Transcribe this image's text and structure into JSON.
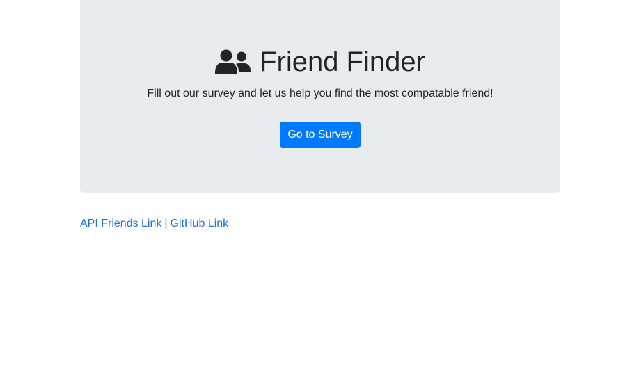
{
  "jumbotron": {
    "title": "Friend Finder",
    "title_icon": "user-friends-icon",
    "subtitle": "Fill out our survey and let us help you find the most compatable friend!",
    "button_label": "Go to Survey"
  },
  "footer": {
    "api_link": "API Friends Link",
    "separator": "|",
    "github_link": "GitHub Link"
  },
  "colors": {
    "jumbotron_bg": "#e9ecef",
    "primary_button": "#007bff",
    "link": "#1a73d9",
    "text": "#212529"
  }
}
